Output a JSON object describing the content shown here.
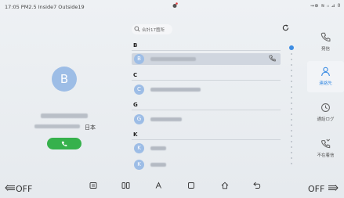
{
  "status_bar": {
    "left_text": "17:05 PM2.5 Inside7 Outside19",
    "right_text": "⇝⊕ ≋ ᵢₗ ⊿ 0"
  },
  "contact": {
    "avatar_letter": "B",
    "region": "日本"
  },
  "search": {
    "placeholder": "合計17箇所"
  },
  "sections": [
    {
      "letter": "B",
      "rows": [
        {
          "avatar": "B",
          "selected": true
        }
      ]
    },
    {
      "letter": "C",
      "rows": [
        {
          "avatar": "C",
          "selected": false
        }
      ]
    },
    {
      "letter": "G",
      "rows": [
        {
          "avatar": "G",
          "selected": false
        }
      ]
    },
    {
      "letter": "K",
      "rows": [
        {
          "avatar": "K",
          "selected": false
        },
        {
          "avatar": "K",
          "selected": false
        }
      ]
    }
  ],
  "right_nav": [
    {
      "label": "発信",
      "icon": "phone-icon",
      "active": false
    },
    {
      "label": "連絡先",
      "icon": "person-icon",
      "active": true
    },
    {
      "label": "通話ログ",
      "icon": "clock-icon",
      "active": false
    },
    {
      "label": "不在着信",
      "icon": "missed-call-icon",
      "active": false
    }
  ],
  "bottom_bar": {
    "left_label": "OFF",
    "right_label": "OFF"
  },
  "colors": {
    "accent": "#3d8de3",
    "avatar": "#9dbde6",
    "call_green": "#36b14c"
  }
}
